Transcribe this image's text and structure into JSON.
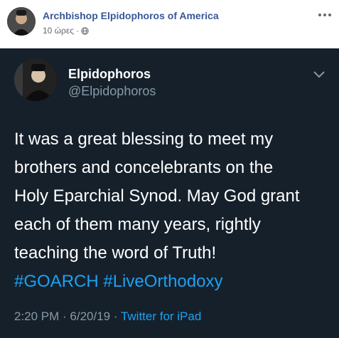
{
  "post": {
    "page_name": "Archbishop Elpidophoros of America",
    "time_ago": "10 ώρες",
    "separator": "·",
    "privacy_icon": "globe-icon",
    "more_icon": "more-options-icon"
  },
  "tweet": {
    "display_name": "Elpidophoros",
    "handle": "@Elpidophoros",
    "text_lines": [
      "It was a great blessing to meet my",
      "brothers and concelebrants on the",
      "Holy Eparchial Synod. May God grant",
      "each of them many years, rightly",
      "teaching the word of Truth!"
    ],
    "hashtags": [
      "#GOARCH",
      "#LiveOrthodoxy"
    ],
    "timestamp": "2:20 PM · 6/20/19 · ",
    "source": "Twitter for iPad",
    "chevron_icon": "chevron-down-icon"
  },
  "colors": {
    "tweet_bg": "#15202b",
    "link_blue": "#1da1f2",
    "fb_blue": "#385898",
    "muted": "#8899a6"
  }
}
